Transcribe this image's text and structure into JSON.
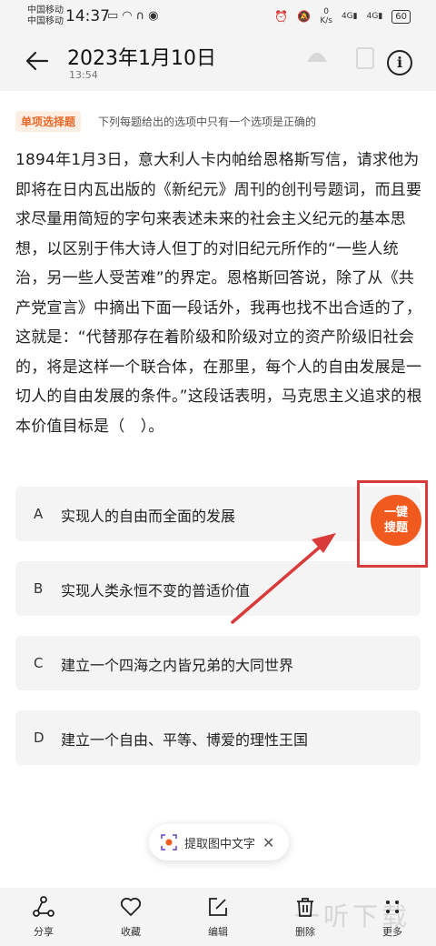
{
  "status_bar": {
    "carrier_1": "中国移动",
    "carrier_2": "中国移动",
    "time": "14:37",
    "speed_value": "0",
    "speed_unit": "K/s",
    "signal_1": "4G",
    "signal_2": "4G",
    "battery": "60"
  },
  "header": {
    "title": "2023年1月10日",
    "subtitle": "13:54"
  },
  "question": {
    "type_badge": "单项选择题",
    "hint": "下列每题给出的选项中只有一个选项是正确的",
    "text": "1894年1月3日，意大利人卡内帕给恩格斯写信，请求他为即将在日内瓦出版的《新纪元》周刊的创刊号题词，而且要求尽量用简短的字句来表述未来的社会主义纪元的基本思想，以区别于伟大诗人但丁的对旧纪元所作的“一些人统治，另一些人受苦难”的界定。恩格斯回答说，除了从《共产党宣言》中摘出下面一段话外，我再也找不出合适的了，这就是：“代替那存在着阶级和阶级对立的资产阶级旧社会的，将是这样一个联合体，在那里，每个人的自由发展是一切人的自由发展的条件。”这段话表明，马克思主义追求的根本价值目标是（　）。"
  },
  "options": [
    {
      "letter": "A",
      "text": "实现人的自由而全面的发展"
    },
    {
      "letter": "B",
      "text": "实现人类永恒不变的普适价值"
    },
    {
      "letter": "C",
      "text": "建立一个四海之内皆兄弟的大同世界"
    },
    {
      "letter": "D",
      "text": "建立一个自由、平等、博爱的理性王国"
    }
  ],
  "search_button": {
    "line1": "一键",
    "line2": "搜题"
  },
  "ocr_pill": {
    "label": "提取图中文字",
    "close": "✕"
  },
  "bottom_bar": [
    {
      "label": "分享",
      "icon": "share-icon"
    },
    {
      "label": "收藏",
      "icon": "heart-icon"
    },
    {
      "label": "编辑",
      "icon": "edit-icon"
    },
    {
      "label": "删除",
      "icon": "trash-icon"
    },
    {
      "label": "更多",
      "icon": "more-icon"
    }
  ],
  "watermark": "一听下载",
  "colors": {
    "accent": "#f05a1e",
    "highlight_box": "#d93a3a",
    "badge_text": "#e86a2a"
  }
}
